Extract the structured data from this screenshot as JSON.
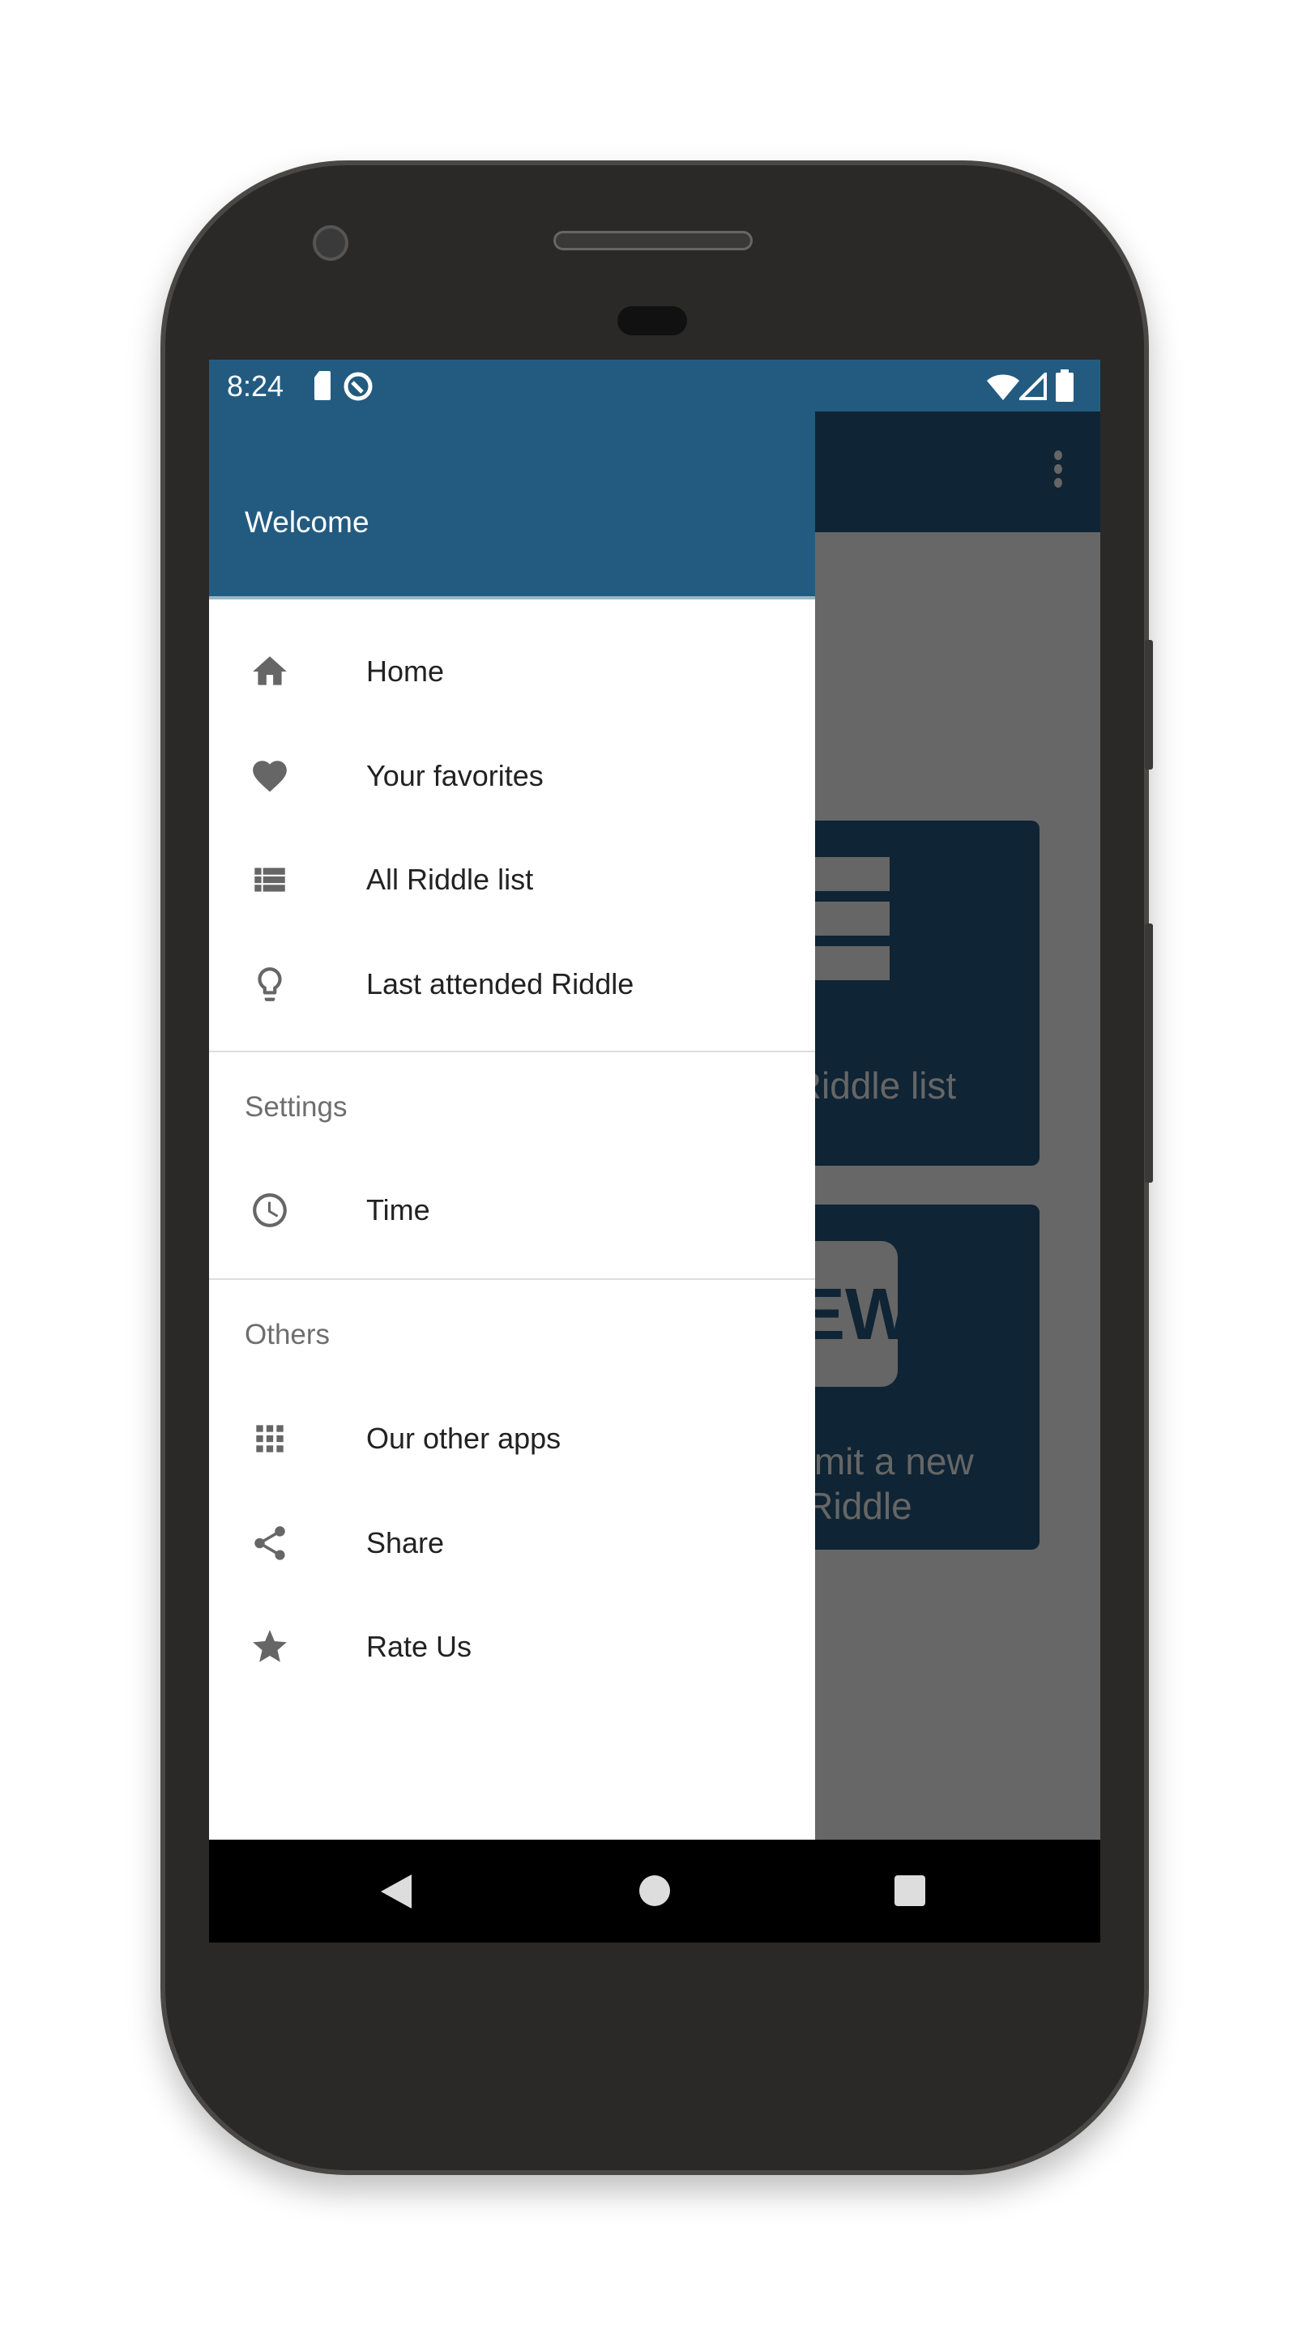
{
  "status_bar": {
    "time": "8:24",
    "icons": [
      "sd-card-icon",
      "data-saver-icon",
      "wifi-icon",
      "signal-icon",
      "battery-icon"
    ]
  },
  "drawer": {
    "header_title": "Welcome",
    "items": [
      {
        "label": "Home",
        "icon": "home-icon"
      },
      {
        "label": "Your favorites",
        "icon": "heart-icon"
      },
      {
        "label": "All Riddle list",
        "icon": "list-icon"
      },
      {
        "label": "Last attended Riddle",
        "icon": "lightbulb-icon"
      }
    ],
    "settings": {
      "title": "Settings",
      "items": [
        {
          "label": "Time",
          "icon": "clock-icon"
        }
      ]
    },
    "others": {
      "title": "Others",
      "items": [
        {
          "label": "Our other apps",
          "icon": "apps-grid-icon"
        },
        {
          "label": "Share",
          "icon": "share-icon"
        },
        {
          "label": "Rate Us",
          "icon": "star-icon"
        }
      ]
    }
  },
  "background": {
    "cards": [
      {
        "label": "Riddle list"
      },
      {
        "label_line1": "omit a new",
        "label_line2": "Riddle",
        "badge": "NEW"
      }
    ]
  },
  "colors": {
    "primary": "#235b80",
    "toolbar_dimmed": "#0f2434",
    "scrim": "#676767"
  }
}
